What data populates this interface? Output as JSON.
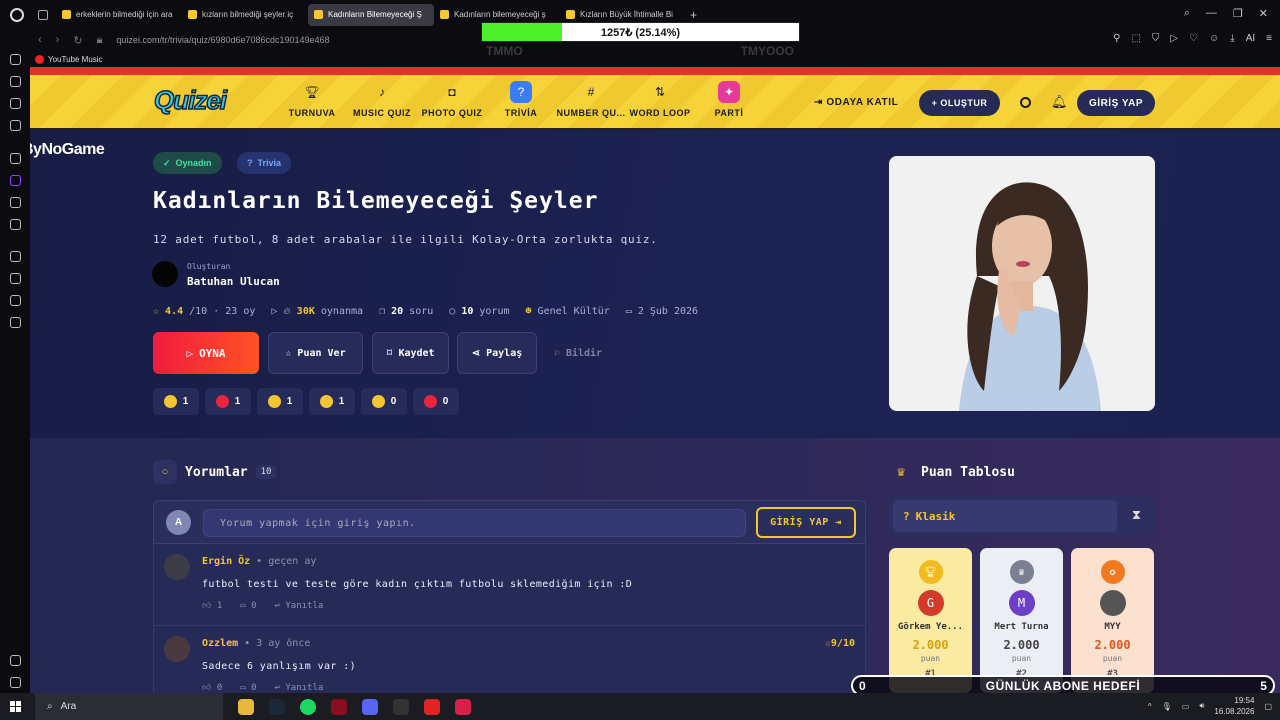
{
  "browser": {
    "tabs": [
      {
        "label": "erkeklerin bilmediği için ara",
        "active": false
      },
      {
        "label": "kızların bilmediği şeyler iç",
        "active": false
      },
      {
        "label": "Kadınların Bilemeyeceği Ş",
        "active": true
      },
      {
        "label": "Kadınların bilemeyeceği ş",
        "active": false
      },
      {
        "label": "Kızların Büyük İhtimalle Bi",
        "active": false
      }
    ],
    "url": "quizei.com/tr/trivia/quiz/6980d6e7086cdc190149e468",
    "bookmark": "YouTube Music",
    "ai_label": "AI"
  },
  "overlay": {
    "progress_text": "1257₺ (25.14%)",
    "progress_fraction": 0.2514,
    "ghost_left": "TMMO",
    "ghost_right": "TMYOOO",
    "goal_left": "0",
    "goal_text": "GÜNLÜK ABONE HEDEFİ",
    "goal_right": "5",
    "bynogame": "ByNoGame"
  },
  "header": {
    "logo": "Quizei",
    "nav": [
      {
        "label": "TURNUVA",
        "icon": "trophy-icon"
      },
      {
        "label": "MUSIC QUIZ",
        "icon": "music-icon"
      },
      {
        "label": "PHOTO QUIZ",
        "icon": "camera-icon"
      },
      {
        "label": "TRİVİA",
        "icon": "question-icon"
      },
      {
        "label": "NUMBER QU...",
        "icon": "hash-icon"
      },
      {
        "label": "WORD LOOP",
        "icon": "sort-icon"
      },
      {
        "label": "PARTİ",
        "icon": "party-icon"
      }
    ],
    "join": "ODAYA KATIL",
    "create": "+ OLUŞTUR",
    "login": "GİRİŞ YAP"
  },
  "quiz": {
    "chip_played": "Oynadın",
    "chip_category": "Trivia",
    "title": "Kadınların Bilemeyeceği Şeyler",
    "description": "12 adet futbol, 8 adet arabalar ile ilgili Kolay-Orta zorlukta quiz.",
    "creator_label": "Oluşturan",
    "creator_name": "Batuhan Ulucan",
    "rating": "4.4",
    "rating_suffix": "/10 · 23 oy",
    "plays": "30K",
    "plays_label": "oynanma",
    "questions": "20",
    "questions_label": "soru",
    "comments": "10",
    "comments_label": "yorum",
    "category": "Genel Kültür",
    "date": "2 Şub 2026",
    "play": "OYNA",
    "rate": "Puan Ver",
    "save": "Kaydet",
    "share": "Paylaş",
    "report": "Bildir",
    "reactions": [
      {
        "name": "thumbs-up",
        "count": "1",
        "color": "#f3c532"
      },
      {
        "name": "heart",
        "count": "1",
        "color": "#e8233d"
      },
      {
        "name": "laugh",
        "count": "1",
        "color": "#f3c532"
      },
      {
        "name": "wow",
        "count": "1",
        "color": "#f3c532"
      },
      {
        "name": "sad",
        "count": "0",
        "color": "#f3c532"
      },
      {
        "name": "angry",
        "count": "0",
        "color": "#e8233d"
      }
    ]
  },
  "comments": {
    "title": "Yorumlar",
    "count": "10",
    "avatar_letter": "A",
    "placeholder": "Yorum yapmak için giriş yapın.",
    "login": "GİRİŞ YAP",
    "items": [
      {
        "author": "Ergin Öz",
        "time": "geçen ay",
        "text": "futbol testi ve teste göre kadın çıktım futbolu sklemediğim için :D",
        "likes": "1",
        "replies": "0",
        "reply_label": "Yanıtla",
        "score": ""
      },
      {
        "author": "Ozzlem",
        "time": "3 ay önce",
        "text": "Sadece 6 yanlışım var :)",
        "likes": "0",
        "replies": "0",
        "reply_label": "Yanıtla",
        "score": "9/10"
      }
    ]
  },
  "leaderboard": {
    "title": "Puan Tablosu",
    "tab": "Klasik",
    "podium": [
      {
        "initial": "G",
        "name": "Görkem Ye...",
        "score": "2.000",
        "label": "puan",
        "rank": "#1",
        "bg": "#fbeaa2",
        "avatar": "#d23a2a",
        "medal": "#f1bb1f"
      },
      {
        "initial": "M",
        "name": "Mert Turna",
        "score": "2.000",
        "label": "puan",
        "rank": "#2",
        "bg": "#eceef5",
        "avatar": "#6b3fc7",
        "medal": "#7b7f94"
      },
      {
        "initial": "",
        "name": "MYY",
        "score": "2.000",
        "label": "puan",
        "rank": "#3",
        "bg": "#fde1cf",
        "avatar": "#555555",
        "medal": "#f07a22"
      }
    ]
  },
  "taskbar": {
    "search": "Ara",
    "time": "19:54",
    "date": "16.08.2026"
  }
}
